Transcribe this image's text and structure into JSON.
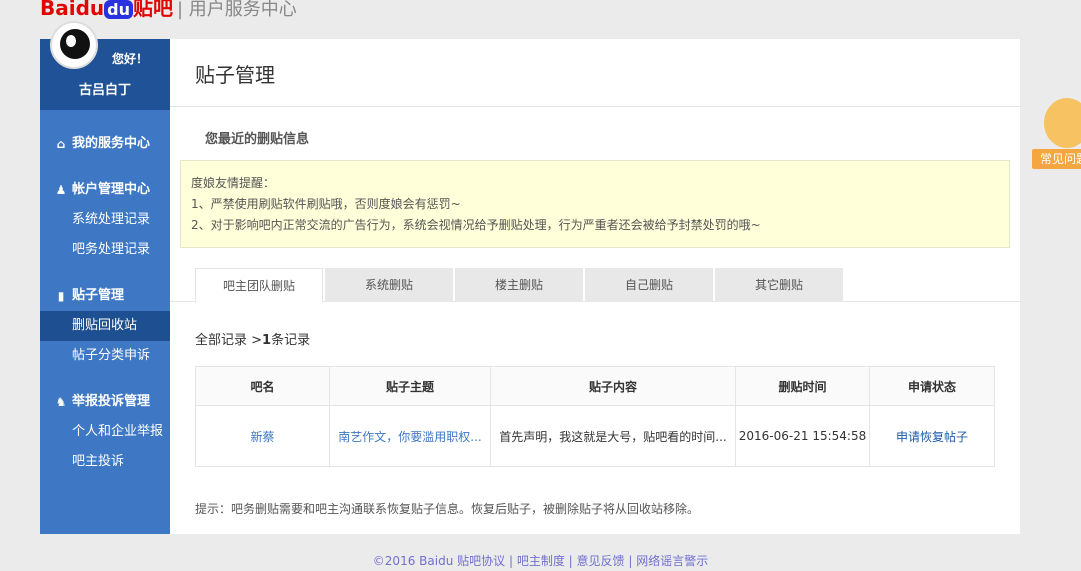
{
  "header": {
    "logo_brand": "Baidu",
    "logo_tieba": "贴吧",
    "logo_sub": "| 用户服务中心"
  },
  "user": {
    "greeting": "您好！",
    "name": "古吕白丁"
  },
  "sidebar": {
    "sections": [
      {
        "label": "我的服务中心",
        "icon": "home-icon",
        "items": []
      },
      {
        "label": "帐户管理中心",
        "icon": "user-icon",
        "items": [
          "系统处理记录",
          "吧务处理记录"
        ]
      },
      {
        "label": "贴子管理",
        "icon": "document-icon",
        "items": [
          "删贴回收站",
          "帖子分类申诉"
        ]
      },
      {
        "label": "举报投诉管理",
        "icon": "report-user-icon",
        "items": [
          "个人和企业举报",
          "吧主投诉"
        ]
      }
    ],
    "active_item": "删贴回收站"
  },
  "main": {
    "title": "贴子管理",
    "subtitle": "您最近的删贴信息",
    "notice": [
      "度娘友情提醒：",
      "1、严禁使用刷贴软件刷贴哦，否则度娘会有惩罚~",
      "2、对于影响吧内正常交流的广告行为，系统会视情况给予删贴处理，行为严重者还会被给予封禁处罚的哦~"
    ],
    "tabs": [
      "吧主团队删贴",
      "系统删贴",
      "楼主删贴",
      "自己删贴",
      "其它删贴"
    ],
    "active_tab": "吧主团队删贴",
    "crumb_all": "全部记录",
    "crumb_sep": " >",
    "crumb_count": "1",
    "crumb_suffix": "条记录",
    "table": {
      "headers": [
        "吧名",
        "贴子主题",
        "贴子内容",
        "删贴时间",
        "申请状态"
      ],
      "rows": [
        [
          "新蔡",
          "南艺作文，你要滥用职权...",
          "首先声明，我这就是大号，贴吧看的时间...",
          "2016-06-21 15:54:58",
          "申请恢复帖子"
        ]
      ]
    },
    "hint": "提示：吧务删贴需要和吧主沟通联系恢复贴子信息。恢复后贴子，被删除贴子将从回收站移除。"
  },
  "faq": {
    "label": "常见问题"
  },
  "footer": {
    "copyright": "©2016 Baidu",
    "links": [
      "贴吧协议",
      "吧主制度",
      "意见反馈",
      "网络谣言警示"
    ]
  },
  "colors": {
    "sidebar": "#3e78c4",
    "sidebar_dark": "#1f5296",
    "notice_bg": "#ffffd9",
    "link": "#3e78c4"
  }
}
